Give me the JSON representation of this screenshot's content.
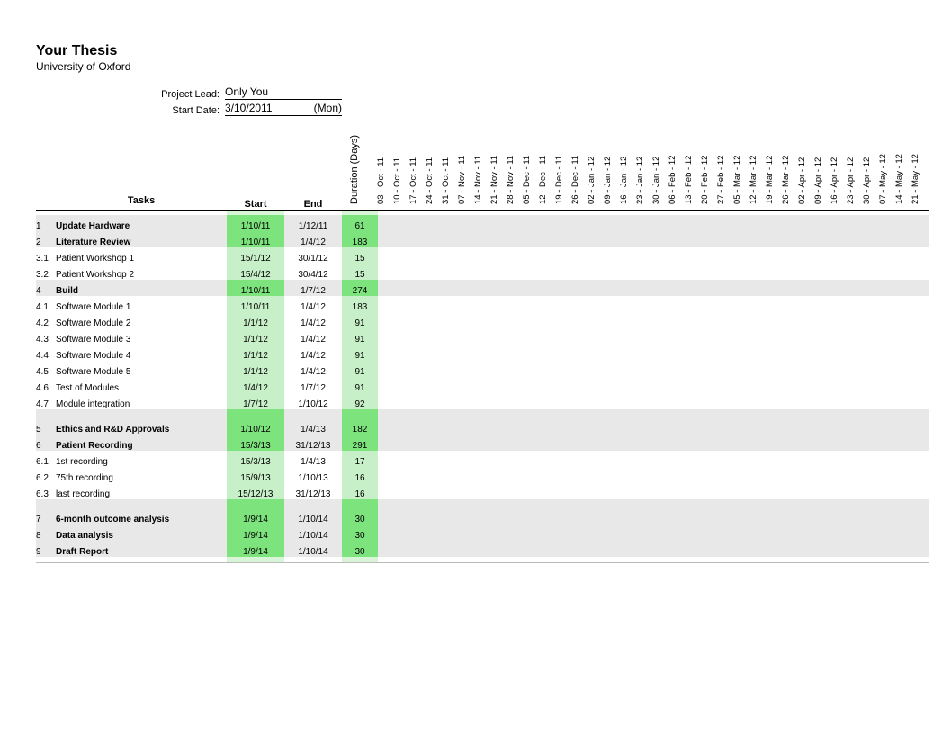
{
  "header": {
    "title": "Your Thesis",
    "subtitle": "University of Oxford",
    "project_lead_label": "Project Lead:",
    "project_lead_value": "Only You",
    "start_date_label": "Start Date:",
    "start_date_value": "3/10/2011",
    "start_date_dow": "(Mon)"
  },
  "columns": {
    "tasks": "Tasks",
    "start": "Start",
    "end": "End",
    "duration": "Duration (Days)"
  },
  "weeks": [
    "03 - Oct - 11",
    "10 - Oct - 11",
    "17 - Oct - 11",
    "24 - Oct - 11",
    "31 - Oct - 11",
    "07 - Nov - 11",
    "14 - Nov - 11",
    "21 - Nov - 11",
    "28 - Nov - 11",
    "05 - Dec - 11",
    "12 - Dec - 11",
    "19 - Dec - 11",
    "26 - Dec - 11",
    "02 - Jan - 12",
    "09 - Jan - 12",
    "16 - Jan - 12",
    "23 - Jan - 12",
    "30 - Jan - 12",
    "06 - Feb - 12",
    "13 - Feb - 12",
    "20 - Feb - 12",
    "27 - Feb - 12",
    "05 - Mar - 12",
    "12 - Mar - 12",
    "19 - Mar - 12",
    "26 - Mar - 12",
    "02 - Apr - 12",
    "09 - Apr - 12",
    "16 - Apr - 12",
    "23 - Apr - 12",
    "30 - Apr - 12",
    "07 - May - 12",
    "14 - May - 12",
    "21 - May - 12"
  ],
  "rows": [
    {
      "id": "1",
      "task": "Update Hardware",
      "start": "1/10/11",
      "end": "1/12/11",
      "dur": "61",
      "group": true
    },
    {
      "id": "2",
      "task": "Literature Review",
      "start": "1/10/11",
      "end": "1/4/12",
      "dur": "183",
      "group": true
    },
    {
      "id": "3.1",
      "task": "Patient Workshop 1",
      "start": "15/1/12",
      "end": "30/1/12",
      "dur": "15",
      "group": false
    },
    {
      "id": "3.2",
      "task": "Patient Workshop 2",
      "start": "15/4/12",
      "end": "30/4/12",
      "dur": "15",
      "group": false
    },
    {
      "id": "4",
      "task": "Build",
      "start": "1/10/11",
      "end": "1/7/12",
      "dur": "274",
      "group": true
    },
    {
      "id": "4.1",
      "task": "Software Module 1",
      "start": "1/10/11",
      "end": "1/4/12",
      "dur": "183",
      "group": false
    },
    {
      "id": "4.2",
      "task": "Software Module 2",
      "start": "1/1/12",
      "end": "1/4/12",
      "dur": "91",
      "group": false
    },
    {
      "id": "4.3",
      "task": "Software Module 3",
      "start": "1/1/12",
      "end": "1/4/12",
      "dur": "91",
      "group": false
    },
    {
      "id": "4.4",
      "task": "Software Module 4",
      "start": "1/1/12",
      "end": "1/4/12",
      "dur": "91",
      "group": false
    },
    {
      "id": "4.5",
      "task": "Software Module 5",
      "start": "1/1/12",
      "end": "1/4/12",
      "dur": "91",
      "group": false
    },
    {
      "id": "4.6",
      "task": "Test of Modules",
      "start": "1/4/12",
      "end": "1/7/12",
      "dur": "91",
      "group": false
    },
    {
      "id": "4.7",
      "task": "Module integration",
      "start": "1/7/12",
      "end": "1/10/12",
      "dur": "92",
      "group": false
    },
    {
      "id": "5",
      "task": "Ethics and R&D Approvals",
      "start": "1/10/12",
      "end": "1/4/13",
      "dur": "182",
      "group": true,
      "twoline": true
    },
    {
      "id": "6",
      "task": "Patient Recording",
      "start": "15/3/13",
      "end": "31/12/13",
      "dur": "291",
      "group": true
    },
    {
      "id": "6.1",
      "task": "1st  recording",
      "start": "15/3/13",
      "end": "1/4/13",
      "dur": "17",
      "group": false
    },
    {
      "id": "6.2",
      "task": "75th recording",
      "start": "15/9/13",
      "end": "1/10/13",
      "dur": "16",
      "group": false
    },
    {
      "id": "6.3",
      "task": "last recording",
      "start": "15/12/13",
      "end": "31/12/13",
      "dur": "16",
      "group": false
    },
    {
      "id": "7",
      "task": "6-month  outcome analysis",
      "start": "1/9/14",
      "end": "1/10/14",
      "dur": "30",
      "group": true,
      "twoline": true
    },
    {
      "id": "8",
      "task": "Data analysis",
      "start": "1/9/14",
      "end": "1/10/14",
      "dur": "30",
      "group": true
    },
    {
      "id": "9",
      "task": "Draft Report",
      "start": "1/9/14",
      "end": "1/10/14",
      "dur": "30",
      "group": true
    }
  ]
}
